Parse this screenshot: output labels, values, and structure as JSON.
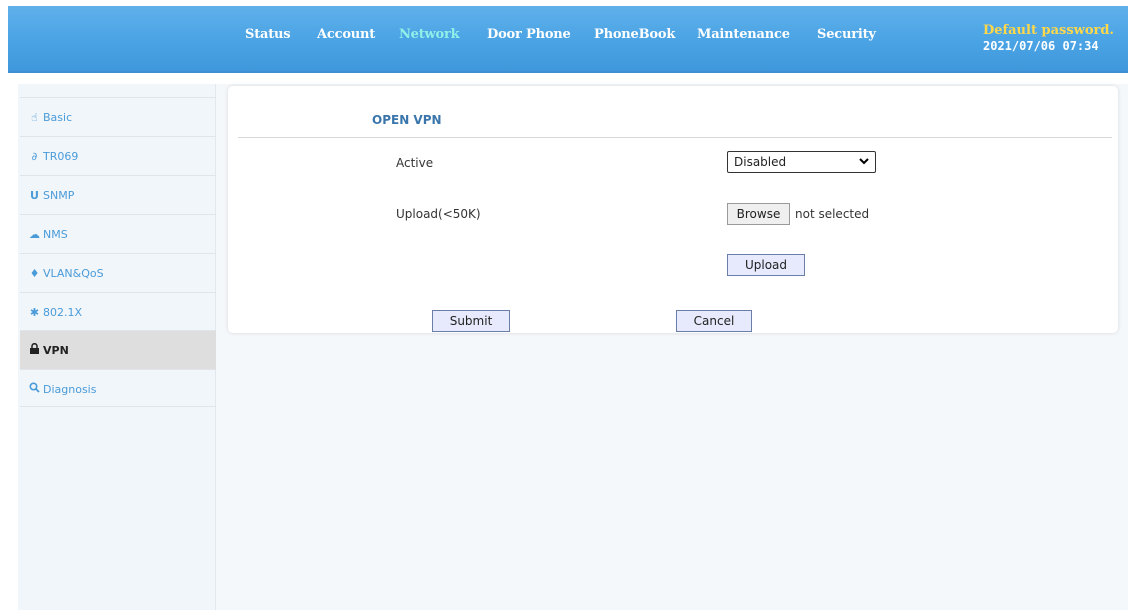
{
  "header": {
    "nav": [
      {
        "label": "Status",
        "active": false
      },
      {
        "label": "Account",
        "active": false
      },
      {
        "label": "Network",
        "active": true
      },
      {
        "label": "Door Phone",
        "active": false
      },
      {
        "label": "PhoneBook",
        "active": false
      },
      {
        "label": "Maintenance",
        "active": false
      },
      {
        "label": "Security",
        "active": false
      }
    ],
    "warning": "Default password.",
    "datetime": "2021/07/06 07:34"
  },
  "sidebar": {
    "items": [
      {
        "label": "Basic",
        "icon": "hand-icon"
      },
      {
        "label": "TR069",
        "icon": "link-icon"
      },
      {
        "label": "SNMP",
        "icon": "magnet-icon"
      },
      {
        "label": "NMS",
        "icon": "cloud-icon"
      },
      {
        "label": "VLAN&QoS",
        "icon": "map-marker-icon"
      },
      {
        "label": "802.1X",
        "icon": "asterisk-icon"
      },
      {
        "label": "VPN",
        "icon": "lock-icon",
        "active": true
      },
      {
        "label": "Diagnosis",
        "icon": "zoom-icon"
      }
    ]
  },
  "panel": {
    "title": "OPEN VPN",
    "active_label": "Active",
    "active_value": "Disabled",
    "upload_label": "Upload(<50K)",
    "browse_label": "Browse",
    "file_status": "not selected",
    "upload_button": "Upload",
    "submit_button": "Submit",
    "cancel_button": "Cancel"
  },
  "colors": {
    "header_blue": "#4aa3e4",
    "active_nav": "#8ff0e8",
    "warning": "#ffd84a",
    "sidebar_link": "#4a9bd8",
    "title_blue": "#3a76ab"
  }
}
